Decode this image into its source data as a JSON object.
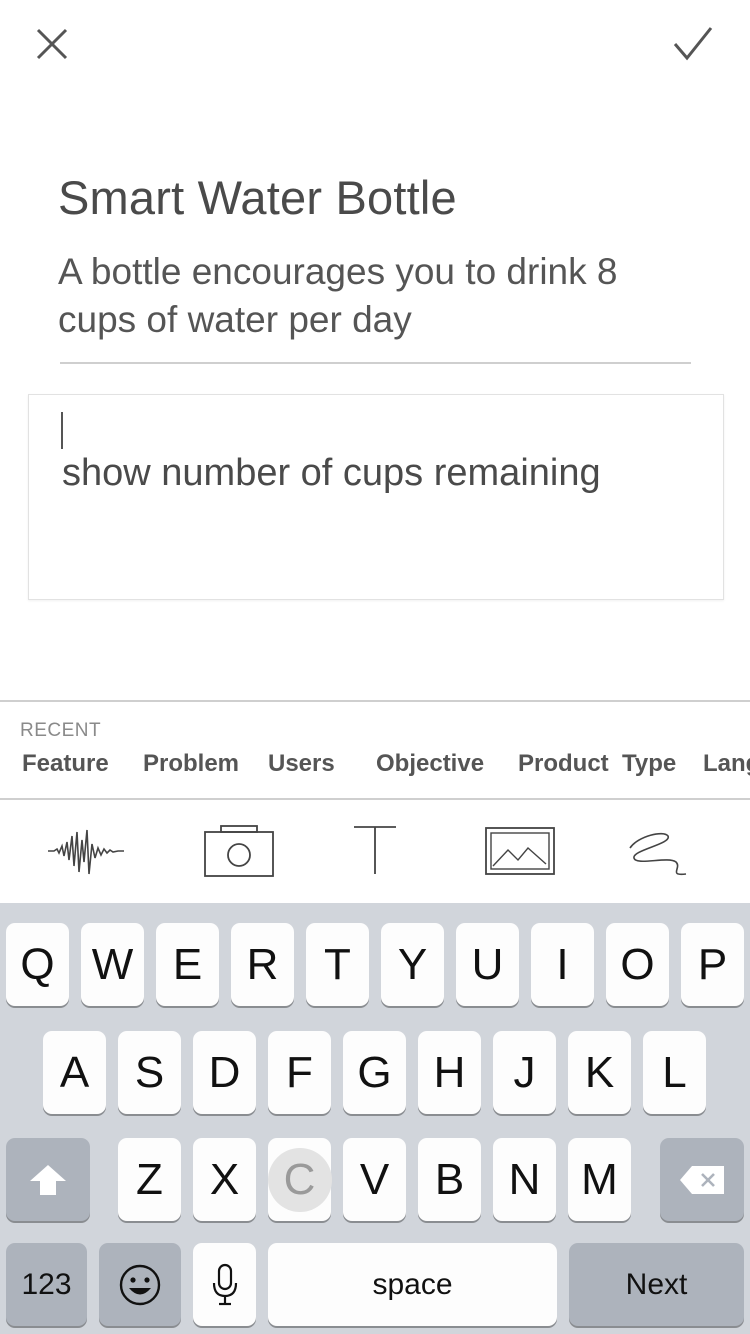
{
  "header": {
    "close_icon": "close-icon",
    "confirm_icon": "checkmark-icon"
  },
  "idea": {
    "title": "Smart Water Bottle",
    "subtitle": "A bottle encourages you to drink 8 cups of water per day"
  },
  "note": {
    "text": "show number of cups remaining"
  },
  "recent": {
    "heading": "RECENT",
    "tags": [
      "Feature",
      "Problem",
      "Users",
      "Objective",
      "Product  Type",
      "Lang"
    ]
  },
  "tools": [
    "audio-waveform-icon",
    "camera-icon",
    "text-icon",
    "image-icon",
    "sketch-icon"
  ],
  "keyboard": {
    "row1": [
      "Q",
      "W",
      "E",
      "R",
      "T",
      "Y",
      "U",
      "I",
      "O",
      "P"
    ],
    "row2": [
      "A",
      "S",
      "D",
      "F",
      "G",
      "H",
      "J",
      "K",
      "L"
    ],
    "row3": [
      "Z",
      "X",
      "C",
      "V",
      "B",
      "N",
      "M"
    ],
    "pressed_key": "C",
    "numbers_label": "123",
    "space_label": "space",
    "next_label": "Next"
  }
}
